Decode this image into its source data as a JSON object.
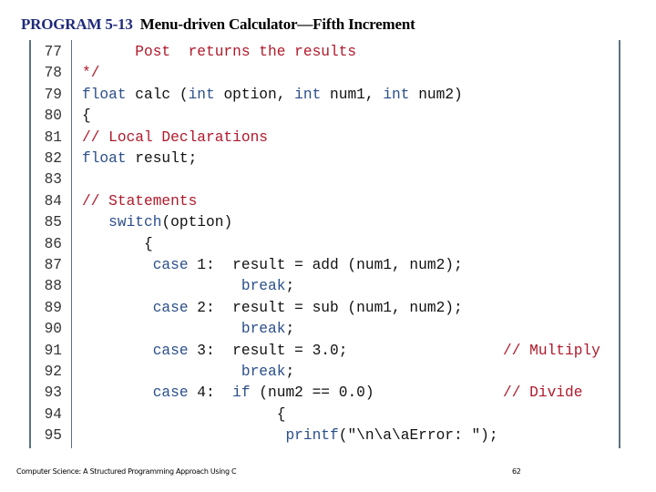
{
  "slide": {
    "program_label": "PROGRAM 5-13",
    "title": "Menu-driven Calculator—Fifth Increment",
    "footer_text": "Computer Science: A Structured Programming Approach Using C",
    "page_number": "62"
  },
  "colors": {
    "keyword": "#2b4f8a",
    "comment": "#b0192b",
    "text": "#111111",
    "border": "#5a7380"
  },
  "code_lines": [
    {
      "num": "77",
      "segments": [
        {
          "t": "      Post  returns the results",
          "c": "cm"
        }
      ]
    },
    {
      "num": "78",
      "segments": [
        {
          "t": "*/",
          "c": "cm"
        }
      ]
    },
    {
      "num": "79",
      "segments": [
        {
          "t": "float",
          "c": "kw"
        },
        {
          "t": " calc (",
          "c": ""
        },
        {
          "t": "int",
          "c": "kw"
        },
        {
          "t": " option, ",
          "c": ""
        },
        {
          "t": "int",
          "c": "kw"
        },
        {
          "t": " num1, ",
          "c": ""
        },
        {
          "t": "int",
          "c": "kw"
        },
        {
          "t": " num2)",
          "c": ""
        }
      ]
    },
    {
      "num": "80",
      "segments": [
        {
          "t": "{",
          "c": ""
        }
      ]
    },
    {
      "num": "81",
      "segments": [
        {
          "t": "// Local Declarations",
          "c": "cm"
        }
      ]
    },
    {
      "num": "82",
      "segments": [
        {
          "t": "float",
          "c": "kw"
        },
        {
          "t": " result;",
          "c": ""
        }
      ]
    },
    {
      "num": "83",
      "segments": []
    },
    {
      "num": "84",
      "segments": [
        {
          "t": "// Statements",
          "c": "cm"
        }
      ]
    },
    {
      "num": "85",
      "segments": [
        {
          "t": "   ",
          "c": ""
        },
        {
          "t": "switch",
          "c": "kw"
        },
        {
          "t": "(option)",
          "c": ""
        }
      ]
    },
    {
      "num": "86",
      "segments": [
        {
          "t": "       {",
          "c": ""
        }
      ]
    },
    {
      "num": "87",
      "segments": [
        {
          "t": "        ",
          "c": ""
        },
        {
          "t": "case",
          "c": "kw"
        },
        {
          "t": " 1:  result = add (num1, num2);",
          "c": ""
        }
      ]
    },
    {
      "num": "88",
      "segments": [
        {
          "t": "                  ",
          "c": ""
        },
        {
          "t": "break",
          "c": "kw"
        },
        {
          "t": ";",
          "c": ""
        }
      ]
    },
    {
      "num": "89",
      "segments": [
        {
          "t": "        ",
          "c": ""
        },
        {
          "t": "case",
          "c": "kw"
        },
        {
          "t": " 2:  result = sub (num1, num2);",
          "c": ""
        }
      ]
    },
    {
      "num": "90",
      "segments": [
        {
          "t": "                  ",
          "c": ""
        },
        {
          "t": "break",
          "c": "kw"
        },
        {
          "t": ";",
          "c": ""
        }
      ]
    },
    {
      "num": "91",
      "segments": [
        {
          "t": "        ",
          "c": ""
        },
        {
          "t": "case",
          "c": "kw"
        },
        {
          "t": " 3:  result = 3.0;",
          "c": ""
        }
      ],
      "right_comment": "// Multiply"
    },
    {
      "num": "92",
      "segments": [
        {
          "t": "                  ",
          "c": ""
        },
        {
          "t": "break",
          "c": "kw"
        },
        {
          "t": ";",
          "c": ""
        }
      ]
    },
    {
      "num": "93",
      "segments": [
        {
          "t": "        ",
          "c": ""
        },
        {
          "t": "case",
          "c": "kw"
        },
        {
          "t": " 4:  ",
          "c": ""
        },
        {
          "t": "if",
          "c": "kw"
        },
        {
          "t": " (num2 == 0.0)",
          "c": ""
        }
      ],
      "right_comment": "// Divide"
    },
    {
      "num": "94",
      "segments": [
        {
          "t": "                      {",
          "c": ""
        }
      ]
    },
    {
      "num": "95",
      "segments": [
        {
          "t": "                       ",
          "c": ""
        },
        {
          "t": "printf",
          "c": "kw"
        },
        {
          "t": "(\"\\n\\a\\aError: \");",
          "c": ""
        }
      ]
    }
  ]
}
